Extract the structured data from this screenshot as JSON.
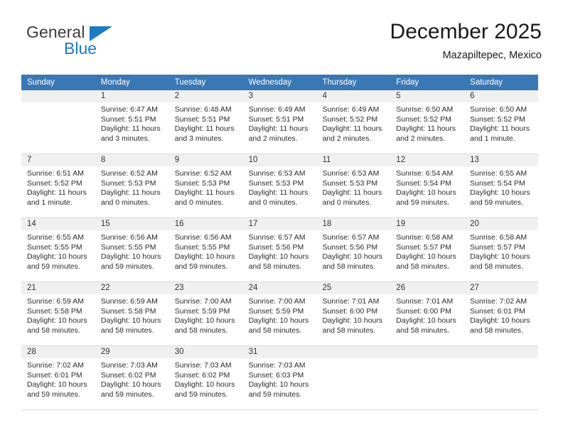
{
  "brand": {
    "word_one": "General",
    "word_two": "Blue",
    "triangle_color": "#1b7ac4",
    "text_color": "#3c3c3c"
  },
  "header": {
    "title": "December 2025",
    "subtitle": "Mazapiltepec, Mexico"
  },
  "calendar": {
    "header_color": "#3a78b5",
    "weekdays": [
      "Sunday",
      "Monday",
      "Tuesday",
      "Wednesday",
      "Thursday",
      "Friday",
      "Saturday"
    ],
    "weeks": [
      [
        {
          "day": "",
          "lines": []
        },
        {
          "day": "1",
          "lines": [
            "Sunrise: 6:47 AM",
            "Sunset: 5:51 PM",
            "Daylight: 11 hours",
            "and 3 minutes."
          ]
        },
        {
          "day": "2",
          "lines": [
            "Sunrise: 6:48 AM",
            "Sunset: 5:51 PM",
            "Daylight: 11 hours",
            "and 3 minutes."
          ]
        },
        {
          "day": "3",
          "lines": [
            "Sunrise: 6:49 AM",
            "Sunset: 5:51 PM",
            "Daylight: 11 hours",
            "and 2 minutes."
          ]
        },
        {
          "day": "4",
          "lines": [
            "Sunrise: 6:49 AM",
            "Sunset: 5:52 PM",
            "Daylight: 11 hours",
            "and 2 minutes."
          ]
        },
        {
          "day": "5",
          "lines": [
            "Sunrise: 6:50 AM",
            "Sunset: 5:52 PM",
            "Daylight: 11 hours",
            "and 2 minutes."
          ]
        },
        {
          "day": "6",
          "lines": [
            "Sunrise: 6:50 AM",
            "Sunset: 5:52 PM",
            "Daylight: 11 hours",
            "and 1 minute."
          ]
        }
      ],
      [
        {
          "day": "7",
          "lines": [
            "Sunrise: 6:51 AM",
            "Sunset: 5:52 PM",
            "Daylight: 11 hours",
            "and 1 minute."
          ]
        },
        {
          "day": "8",
          "lines": [
            "Sunrise: 6:52 AM",
            "Sunset: 5:53 PM",
            "Daylight: 11 hours",
            "and 0 minutes."
          ]
        },
        {
          "day": "9",
          "lines": [
            "Sunrise: 6:52 AM",
            "Sunset: 5:53 PM",
            "Daylight: 11 hours",
            "and 0 minutes."
          ]
        },
        {
          "day": "10",
          "lines": [
            "Sunrise: 6:53 AM",
            "Sunset: 5:53 PM",
            "Daylight: 11 hours",
            "and 0 minutes."
          ]
        },
        {
          "day": "11",
          "lines": [
            "Sunrise: 6:53 AM",
            "Sunset: 5:53 PM",
            "Daylight: 11 hours",
            "and 0 minutes."
          ]
        },
        {
          "day": "12",
          "lines": [
            "Sunrise: 6:54 AM",
            "Sunset: 5:54 PM",
            "Daylight: 10 hours",
            "and 59 minutes."
          ]
        },
        {
          "day": "13",
          "lines": [
            "Sunrise: 6:55 AM",
            "Sunset: 5:54 PM",
            "Daylight: 10 hours",
            "and 59 minutes."
          ]
        }
      ],
      [
        {
          "day": "14",
          "lines": [
            "Sunrise: 6:55 AM",
            "Sunset: 5:55 PM",
            "Daylight: 10 hours",
            "and 59 minutes."
          ]
        },
        {
          "day": "15",
          "lines": [
            "Sunrise: 6:56 AM",
            "Sunset: 5:55 PM",
            "Daylight: 10 hours",
            "and 59 minutes."
          ]
        },
        {
          "day": "16",
          "lines": [
            "Sunrise: 6:56 AM",
            "Sunset: 5:55 PM",
            "Daylight: 10 hours",
            "and 59 minutes."
          ]
        },
        {
          "day": "17",
          "lines": [
            "Sunrise: 6:57 AM",
            "Sunset: 5:56 PM",
            "Daylight: 10 hours",
            "and 58 minutes."
          ]
        },
        {
          "day": "18",
          "lines": [
            "Sunrise: 6:57 AM",
            "Sunset: 5:56 PM",
            "Daylight: 10 hours",
            "and 58 minutes."
          ]
        },
        {
          "day": "19",
          "lines": [
            "Sunrise: 6:58 AM",
            "Sunset: 5:57 PM",
            "Daylight: 10 hours",
            "and 58 minutes."
          ]
        },
        {
          "day": "20",
          "lines": [
            "Sunrise: 6:58 AM",
            "Sunset: 5:57 PM",
            "Daylight: 10 hours",
            "and 58 minutes."
          ]
        }
      ],
      [
        {
          "day": "21",
          "lines": [
            "Sunrise: 6:59 AM",
            "Sunset: 5:58 PM",
            "Daylight: 10 hours",
            "and 58 minutes."
          ]
        },
        {
          "day": "22",
          "lines": [
            "Sunrise: 6:59 AM",
            "Sunset: 5:58 PM",
            "Daylight: 10 hours",
            "and 58 minutes."
          ]
        },
        {
          "day": "23",
          "lines": [
            "Sunrise: 7:00 AM",
            "Sunset: 5:59 PM",
            "Daylight: 10 hours",
            "and 58 minutes."
          ]
        },
        {
          "day": "24",
          "lines": [
            "Sunrise: 7:00 AM",
            "Sunset: 5:59 PM",
            "Daylight: 10 hours",
            "and 58 minutes."
          ]
        },
        {
          "day": "25",
          "lines": [
            "Sunrise: 7:01 AM",
            "Sunset: 6:00 PM",
            "Daylight: 10 hours",
            "and 58 minutes."
          ]
        },
        {
          "day": "26",
          "lines": [
            "Sunrise: 7:01 AM",
            "Sunset: 6:00 PM",
            "Daylight: 10 hours",
            "and 58 minutes."
          ]
        },
        {
          "day": "27",
          "lines": [
            "Sunrise: 7:02 AM",
            "Sunset: 6:01 PM",
            "Daylight: 10 hours",
            "and 58 minutes."
          ]
        }
      ],
      [
        {
          "day": "28",
          "lines": [
            "Sunrise: 7:02 AM",
            "Sunset: 6:01 PM",
            "Daylight: 10 hours",
            "and 59 minutes."
          ]
        },
        {
          "day": "29",
          "lines": [
            "Sunrise: 7:03 AM",
            "Sunset: 6:02 PM",
            "Daylight: 10 hours",
            "and 59 minutes."
          ]
        },
        {
          "day": "30",
          "lines": [
            "Sunrise: 7:03 AM",
            "Sunset: 6:02 PM",
            "Daylight: 10 hours",
            "and 59 minutes."
          ]
        },
        {
          "day": "31",
          "lines": [
            "Sunrise: 7:03 AM",
            "Sunset: 6:03 PM",
            "Daylight: 10 hours",
            "and 59 minutes."
          ]
        },
        {
          "day": "",
          "lines": []
        },
        {
          "day": "",
          "lines": []
        },
        {
          "day": "",
          "lines": []
        }
      ]
    ]
  }
}
